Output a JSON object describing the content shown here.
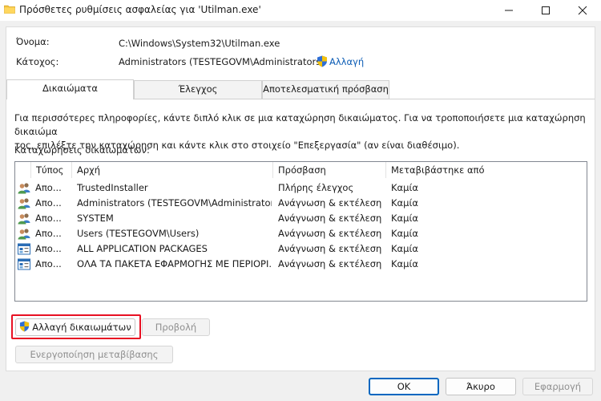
{
  "window": {
    "title": "Πρόσθετες ρυθμίσεις ασφαλείας για 'Utilman.exe'",
    "minimize_icon": "minimize-icon",
    "maximize_icon": "maximize-icon",
    "close_icon": "close-icon"
  },
  "object": {
    "name_label": "Όνομα:",
    "name_value": "C:\\Windows\\System32\\Utilman.exe",
    "owner_label": "Κάτοχος:",
    "owner_value": "Administrators (TESTEGOVM\\Administrators)",
    "change_owner_link": "Αλλαγή"
  },
  "tabs": [
    {
      "label": "Δικαιώματα",
      "active": true
    },
    {
      "label": "Έλεγχος",
      "active": false
    },
    {
      "label": "Αποτελεσματική πρόσβαση",
      "active": false
    }
  ],
  "info_text_line1": "Για περισσότερες πληροφορίες, κάντε διπλό κλικ σε μια καταχώρηση δικαιώματος. Για να τροποποιήσετε μια καταχώρηση δικαιώμα",
  "info_text_line2": "τος, επιλέξτε την καταχώρηση και κάντε κλικ στο στοιχείο \"Επεξεργασία\" (αν είναι διαθέσιμο).",
  "entries_label": "Καταχωρήσεις δικαιωμάτων:",
  "table": {
    "columns": [
      "Τύπος",
      "Αρχή",
      "Πρόσβαση",
      "Μεταβιβάστηκε από"
    ],
    "rows": [
      {
        "icon": "user-group-icon",
        "type": "Απο...",
        "principal": "TrustedInstaller",
        "access": "Πλήρης έλεγχος",
        "inherited": "Καμία"
      },
      {
        "icon": "user-group-icon",
        "type": "Απο...",
        "principal": "Administrators (TESTEGOVM\\Administrators)",
        "access": "Ανάγνωση & εκτέλεση",
        "inherited": "Καμία"
      },
      {
        "icon": "user-group-icon",
        "type": "Απο...",
        "principal": "SYSTEM",
        "access": "Ανάγνωση & εκτέλεση",
        "inherited": "Καμία"
      },
      {
        "icon": "user-group-icon",
        "type": "Απο...",
        "principal": "Users (TESTEGOVM\\Users)",
        "access": "Ανάγνωση & εκτέλεση",
        "inherited": "Καμία"
      },
      {
        "icon": "app-packages-icon",
        "type": "Απο...",
        "principal": "ALL APPLICATION PACKAGES",
        "access": "Ανάγνωση & εκτέλεση",
        "inherited": "Καμία"
      },
      {
        "icon": "app-packages-icon",
        "type": "Απο...",
        "principal": "ΟΛΑ ΤΑ ΠΑΚΕΤΑ ΕΦΑΡΜΟΓΗΣ ΜΕ ΠΕΡΙΟΡΙ...",
        "access": "Ανάγνωση & εκτέλεση",
        "inherited": "Καμία"
      }
    ]
  },
  "buttons": {
    "change_permissions": "Αλλαγή δικαιωμάτων",
    "view": "Προβολή",
    "enable_inheritance": "Ενεργοποίηση μεταβίβασης",
    "ok": "OK",
    "cancel": "Άκυρο",
    "apply": "Εφαρμογή"
  },
  "colors": {
    "link": "#0b5cb5",
    "highlight_frame": "#e81123",
    "primary_border": "#0067c0"
  }
}
